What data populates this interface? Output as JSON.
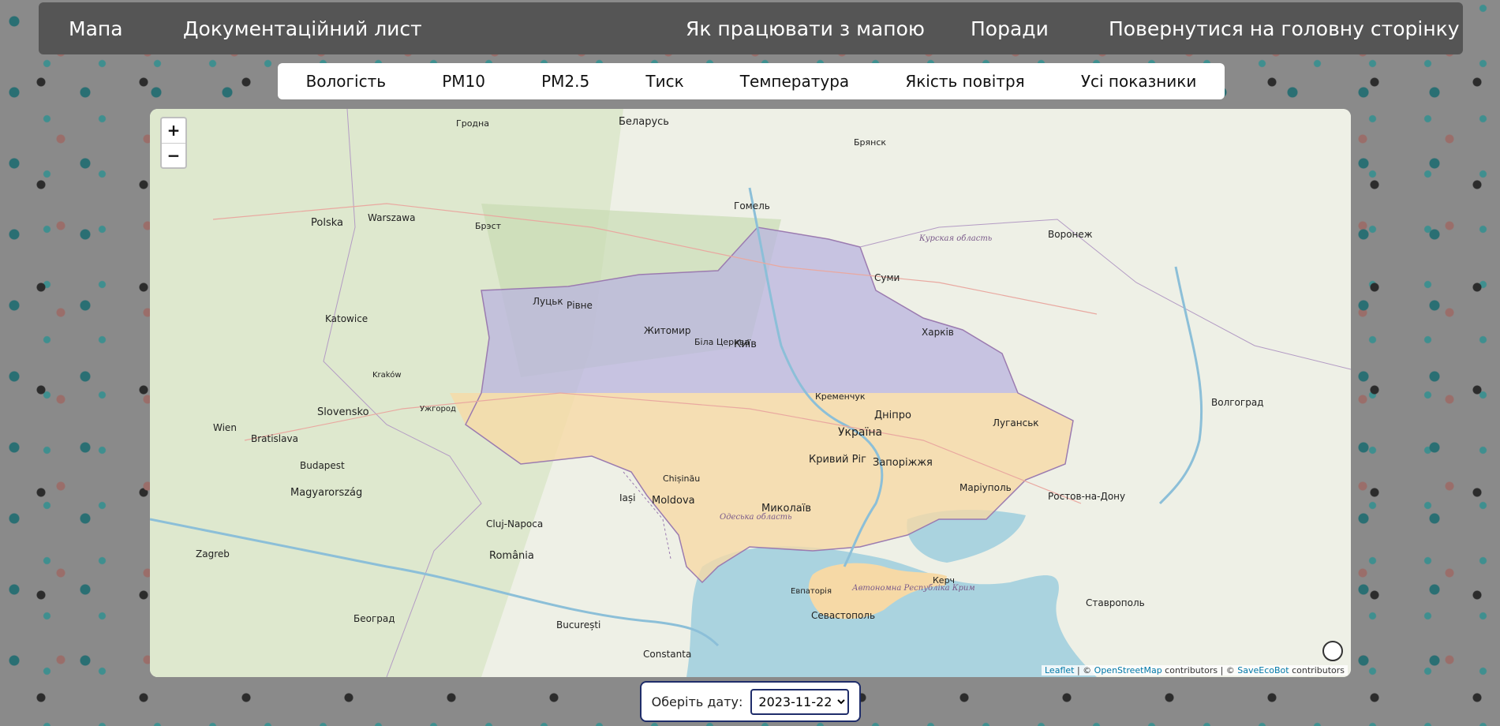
{
  "nav": {
    "items": [
      {
        "label": "Мапа"
      },
      {
        "label": "Документаційний лист"
      },
      {
        "label": "Як працювати з мапою"
      },
      {
        "label": "Поради"
      },
      {
        "label": "Повернутися на головну сторінку"
      }
    ]
  },
  "tabs": [
    {
      "label": "Вологість"
    },
    {
      "label": "PM10"
    },
    {
      "label": "PM2.5"
    },
    {
      "label": "Тиск"
    },
    {
      "label": "Температура"
    },
    {
      "label": "Якість повітря"
    },
    {
      "label": "Усі показники"
    }
  ],
  "map": {
    "zoom_in": "+",
    "zoom_out": "−",
    "labels": {
      "kyiv": "Київ",
      "zhytomyr": "Житомир",
      "rivne": "Рівне",
      "lutsk": "Луцьк",
      "kharkiv": "Харків",
      "sumy": "Суми",
      "dnipro": "Дніпро",
      "zaporizhzhia": "Запоріжжя",
      "kryvyi_rih": "Кривий Ріг",
      "mykolaiv": "Миколаїв",
      "mariupol": "Маріуполь",
      "luhansk": "Луганськ",
      "kremenchuk": "Кременчук",
      "bila_tserkva": "Біла Церква",
      "sevastopol": "Севастополь",
      "evpatoria": "Евпаторія",
      "kerch": "Керч",
      "uzhhorod": "Ужгород",
      "ukraine": "Україна",
      "moldova": "Moldova",
      "romania": "România",
      "belarus": "Беларусь",
      "polska": "Polska",
      "magyarorszag": "Magyarország",
      "slovensko": "Slovensko",
      "warszawa": "Warszawa",
      "bucuresti": "București",
      "budapest": "Budapest",
      "voronezh": "Воронеж",
      "volgograd": "Волгоград",
      "rostov": "Ростов-на-Дону",
      "stavropol": "Ставрополь",
      "bryansk": "Брянск",
      "gomel": "Гомель",
      "brest": "Брэст",
      "hrodna": "Гродна",
      "kursk": "Курская область",
      "crimea": "Автономна Республіка Крим",
      "cluj": "Cluj-Napoca",
      "iasi": "Iași",
      "constanta": "Constanta",
      "chisinau": "Chișinău",
      "odesa": "Одеська область",
      "katowice": "Katowice",
      "wien": "Wien",
      "bratislava": "Bratislava",
      "beograd": "Београд",
      "zagreb": "Zagreb",
      "krakow": "Kraków"
    },
    "attribution": {
      "leaflet": "Leaflet",
      "sep1": " | © ",
      "osm": "OpenStreetMap",
      "mid": " contributors | © ",
      "seb": "SaveEcoBot",
      "end": " contributors"
    }
  },
  "date": {
    "label": "Оберіть дату:",
    "value": "2023-11-22"
  },
  "colors": {
    "overlay_blue": "#b9b4df",
    "overlay_yellow": "#f6d9a6",
    "sea": "#aad3df",
    "nav_bg": "#555555"
  }
}
